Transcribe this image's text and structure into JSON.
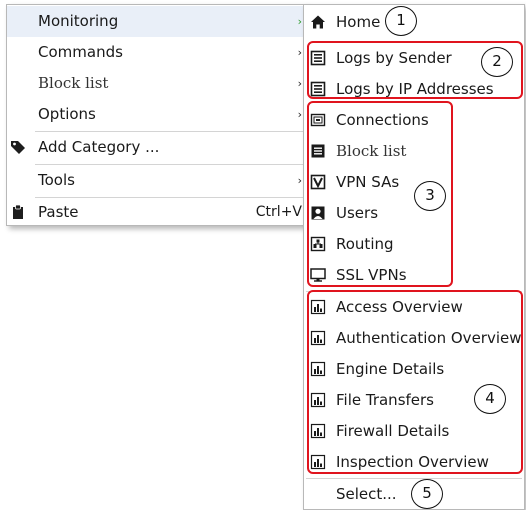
{
  "main_menu": {
    "items": [
      {
        "label": "Monitoring",
        "icon": "",
        "has_submenu": true,
        "highlighted": true
      },
      {
        "label": "Commands",
        "icon": "",
        "has_submenu": true
      },
      {
        "label": "Block list",
        "icon": "",
        "has_submenu": true,
        "serif": true
      },
      {
        "label": "Options",
        "icon": "",
        "has_submenu": true
      },
      {
        "label": "Add Category ...",
        "icon": "tag-icon"
      },
      {
        "label": "Tools",
        "icon": "",
        "has_submenu": true
      },
      {
        "label": "Paste",
        "icon": "clipboard-icon",
        "shortcut": "Ctrl+V"
      }
    ],
    "arrow": "›"
  },
  "submenu": {
    "items": [
      {
        "label": "Home",
        "icon": "home-icon"
      },
      {
        "label": "Logs by Sender",
        "icon": "log-icon"
      },
      {
        "label": "Logs by IP Addresses",
        "icon": "log-icon"
      },
      {
        "label": "Connections",
        "icon": "connections-icon"
      },
      {
        "label": "Block list",
        "icon": "blocklist-icon",
        "serif": true
      },
      {
        "label": "VPN SAs",
        "icon": "vpn-icon"
      },
      {
        "label": "Users",
        "icon": "user-icon"
      },
      {
        "label": "Routing",
        "icon": "routing-icon"
      },
      {
        "label": "SSL VPNs",
        "icon": "monitor-icon"
      },
      {
        "label": "Access Overview",
        "icon": "report-icon"
      },
      {
        "label": "Authentication Overview",
        "icon": "report-icon"
      },
      {
        "label": "Engine Details",
        "icon": "report-icon"
      },
      {
        "label": "File Transfers",
        "icon": "report-icon"
      },
      {
        "label": "Firewall Details",
        "icon": "report-icon"
      },
      {
        "label": "Inspection Overview",
        "icon": "report-icon"
      },
      {
        "label": "Select...",
        "icon": ""
      }
    ]
  },
  "callouts": [
    "1",
    "2",
    "3",
    "4",
    "5"
  ],
  "colors": {
    "highlight": "#e9eff8",
    "callout_border": "#e0141e",
    "submenu_arrow": "#2d9b2d"
  }
}
